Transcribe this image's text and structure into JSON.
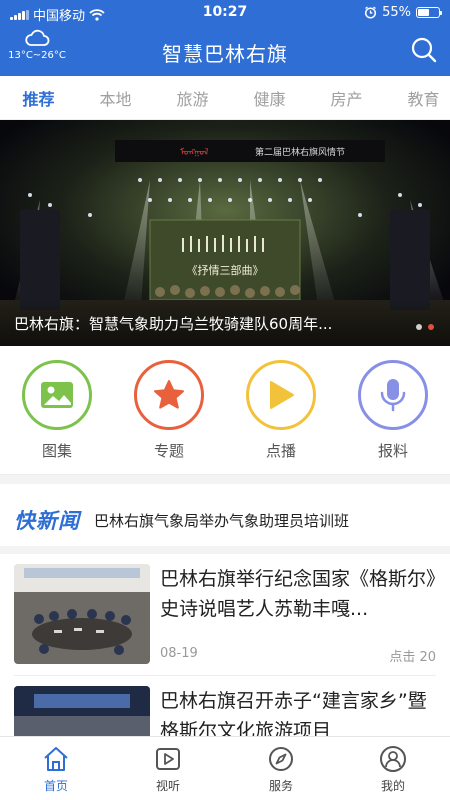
{
  "status_bar": {
    "carrier": "中国移动",
    "time": "10:27",
    "battery": "55%",
    "battery_level": 0.55
  },
  "header": {
    "title": "智慧巴林右旗",
    "weather_range": "13°C~26°C",
    "weather_icon": "cloud-icon",
    "search_icon": "search-icon"
  },
  "tabs": [
    {
      "label": "推荐",
      "active": true
    },
    {
      "label": "本地",
      "active": false
    },
    {
      "label": "旅游",
      "active": false
    },
    {
      "label": "健康",
      "active": false
    },
    {
      "label": "房产",
      "active": false
    },
    {
      "label": "教育",
      "active": false
    }
  ],
  "banner": {
    "title": "巴林右旗：智慧气象助力乌兰牧骑建队60周年...",
    "stage_text": "《抒情三部曲》",
    "dots": 2,
    "active_dot": 1
  },
  "quick_entries": [
    {
      "label": "图集",
      "icon": "image-icon",
      "color": "#7cc24b"
    },
    {
      "label": "专题",
      "icon": "star-icon",
      "color": "#e8603c"
    },
    {
      "label": "点播",
      "icon": "play-icon",
      "color": "#f2c23b"
    },
    {
      "label": "报料",
      "icon": "microphone-icon",
      "color": "#8790e6"
    }
  ],
  "flash_news": {
    "logo": "快新闻",
    "text": "巴林右旗气象局举办气象助理员培训班"
  },
  "news": [
    {
      "title": "巴林右旗举行纪念国家《格斯尔》史诗说唱艺人苏勒丰嘎...",
      "date": "08-19",
      "views": "点击 20"
    },
    {
      "title": "巴林右旗召开赤子“建言家乡”暨格斯尔文化旅游项目",
      "date": "",
      "views": ""
    }
  ],
  "bottom_nav": [
    {
      "label": "首页",
      "icon": "home-icon",
      "active": true
    },
    {
      "label": "视听",
      "icon": "video-icon",
      "active": false
    },
    {
      "label": "服务",
      "icon": "compass-icon",
      "active": false
    },
    {
      "label": "我的",
      "icon": "user-icon",
      "active": false
    }
  ],
  "colors": {
    "primary": "#2f6fd5",
    "banner_dot_active": "#e0513a"
  }
}
